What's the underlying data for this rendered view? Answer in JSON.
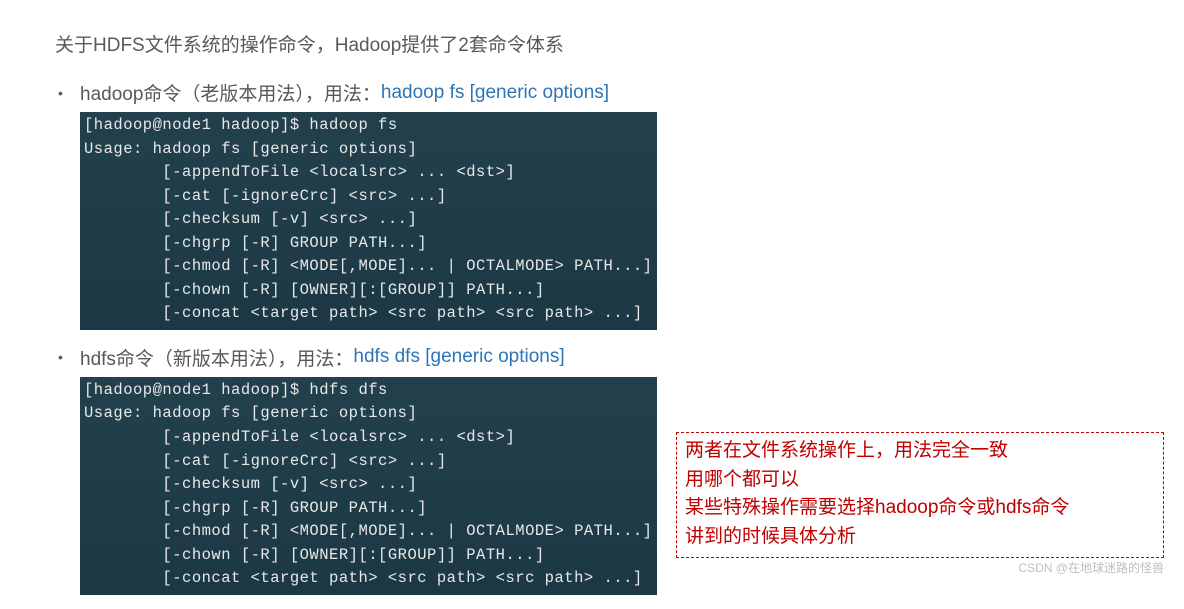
{
  "intro": "关于HDFS文件系统的操作命令，Hadoop提供了2套命令体系",
  "bullets": [
    {
      "text": "hadoop命令（老版本用法），用法：",
      "link": "hadoop fs [generic options]"
    },
    {
      "text": "hdfs命令（新版本用法），用法：",
      "link": "hdfs dfs [generic options]"
    }
  ],
  "terminals": [
    {
      "lines": [
        "[hadoop@node1 hadoop]$ hadoop fs",
        "Usage: hadoop fs [generic options]",
        "        [-appendToFile <localsrc> ... <dst>]",
        "        [-cat [-ignoreCrc] <src> ...]",
        "        [-checksum [-v] <src> ...]",
        "        [-chgrp [-R] GROUP PATH...]",
        "        [-chmod [-R] <MODE[,MODE]... | OCTALMODE> PATH...]",
        "        [-chown [-R] [OWNER][:[GROUP]] PATH...]",
        "        [-concat <target path> <src path> <src path> ...]"
      ]
    },
    {
      "lines": [
        "[hadoop@node1 hadoop]$ hdfs dfs",
        "Usage: hadoop fs [generic options]",
        "        [-appendToFile <localsrc> ... <dst>]",
        "        [-cat [-ignoreCrc] <src> ...]",
        "        [-checksum [-v] <src> ...]",
        "        [-chgrp [-R] GROUP PATH...]",
        "        [-chmod [-R] <MODE[,MODE]... | OCTALMODE> PATH...]",
        "        [-chown [-R] [OWNER][:[GROUP]] PATH...]",
        "        [-concat <target path> <src path> <src path> ...]"
      ]
    }
  ],
  "note": [
    "两者在文件系统操作上，用法完全一致",
    "用哪个都可以",
    "某些特殊操作需要选择hadoop命令或hdfs命令",
    "讲到的时候具体分析"
  ],
  "watermark": "CSDN @在地球迷路的怪兽"
}
